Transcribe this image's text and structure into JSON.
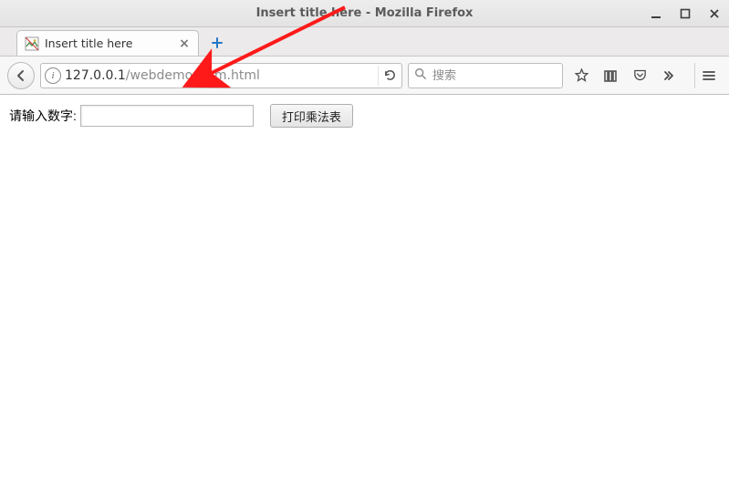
{
  "window": {
    "title": "Insert title here - Mozilla Firefox"
  },
  "tabs": {
    "active": {
      "label": "Insert title here"
    }
  },
  "urlbar": {
    "host": "127.0.0.1",
    "path": "/webdemo/form.html"
  },
  "searchbar": {
    "placeholder": "搜索"
  },
  "page": {
    "label": "请输入数字:",
    "input_value": "",
    "button_label": "打印乘法表"
  }
}
